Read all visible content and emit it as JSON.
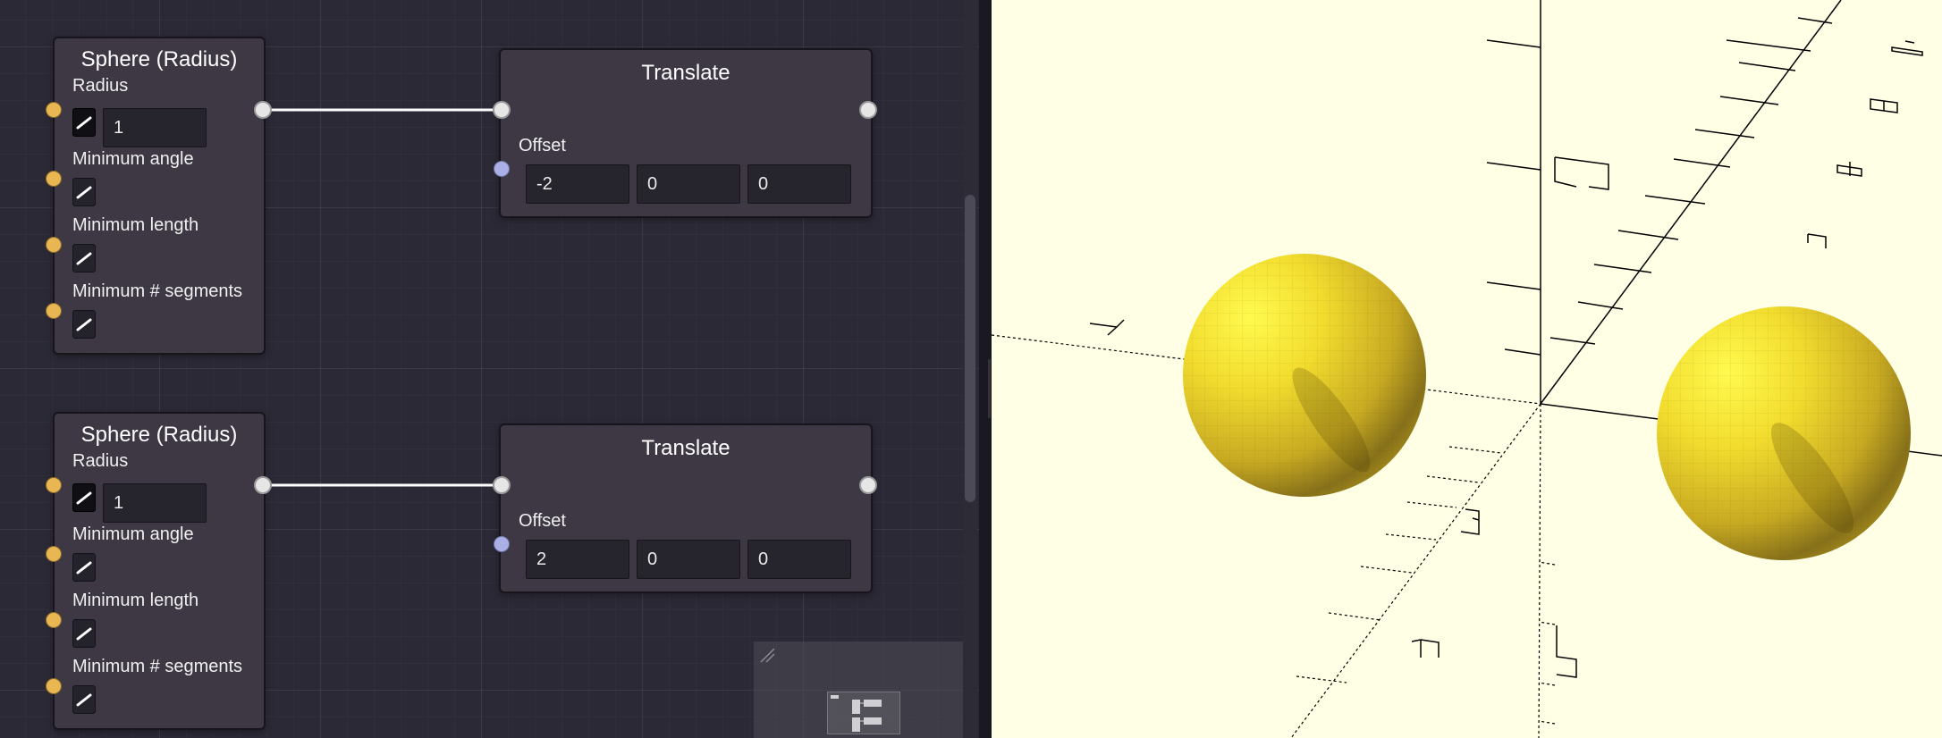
{
  "colors": {
    "editor_background": "#2b2935",
    "node_body": "#3d3844",
    "input_port_number": "#e8b652",
    "input_port_vector": "#aab0e6",
    "output_port": "#e6e6e6",
    "wire": "#ffffff",
    "viewport_background": "#ffffe5",
    "sphere": "#e8cf28"
  },
  "editor": {
    "nodes": [
      {
        "title": "Sphere (Radius)",
        "radius_label": "Radius",
        "radius_value": "1",
        "min_angle_label": "Minimum angle",
        "min_length_label": "Minimum length",
        "min_segments_label": "Minimum # segments"
      },
      {
        "title": "Translate",
        "offset_label": "Offset",
        "offset_x": "-2",
        "offset_y": "0",
        "offset_z": "0"
      },
      {
        "title": "Sphere (Radius)",
        "radius_label": "Radius",
        "radius_value": "1",
        "min_angle_label": "Minimum angle",
        "min_length_label": "Minimum length",
        "min_segments_label": "Minimum # segments"
      },
      {
        "title": "Translate",
        "offset_label": "Offset",
        "offset_x": "2",
        "offset_y": "0",
        "offset_z": "0"
      }
    ],
    "edit_button_icon": "pen-icon",
    "minimap_icon": "minimap-corner-icon"
  },
  "viewport": {
    "objects": [
      "sphere",
      "sphere"
    ],
    "axes": [
      "x",
      "y",
      "z"
    ],
    "tick_labels": [
      "1",
      "2",
      "3",
      "4",
      "5",
      "6",
      "7",
      "8",
      "-1",
      "-2",
      "-4"
    ]
  }
}
